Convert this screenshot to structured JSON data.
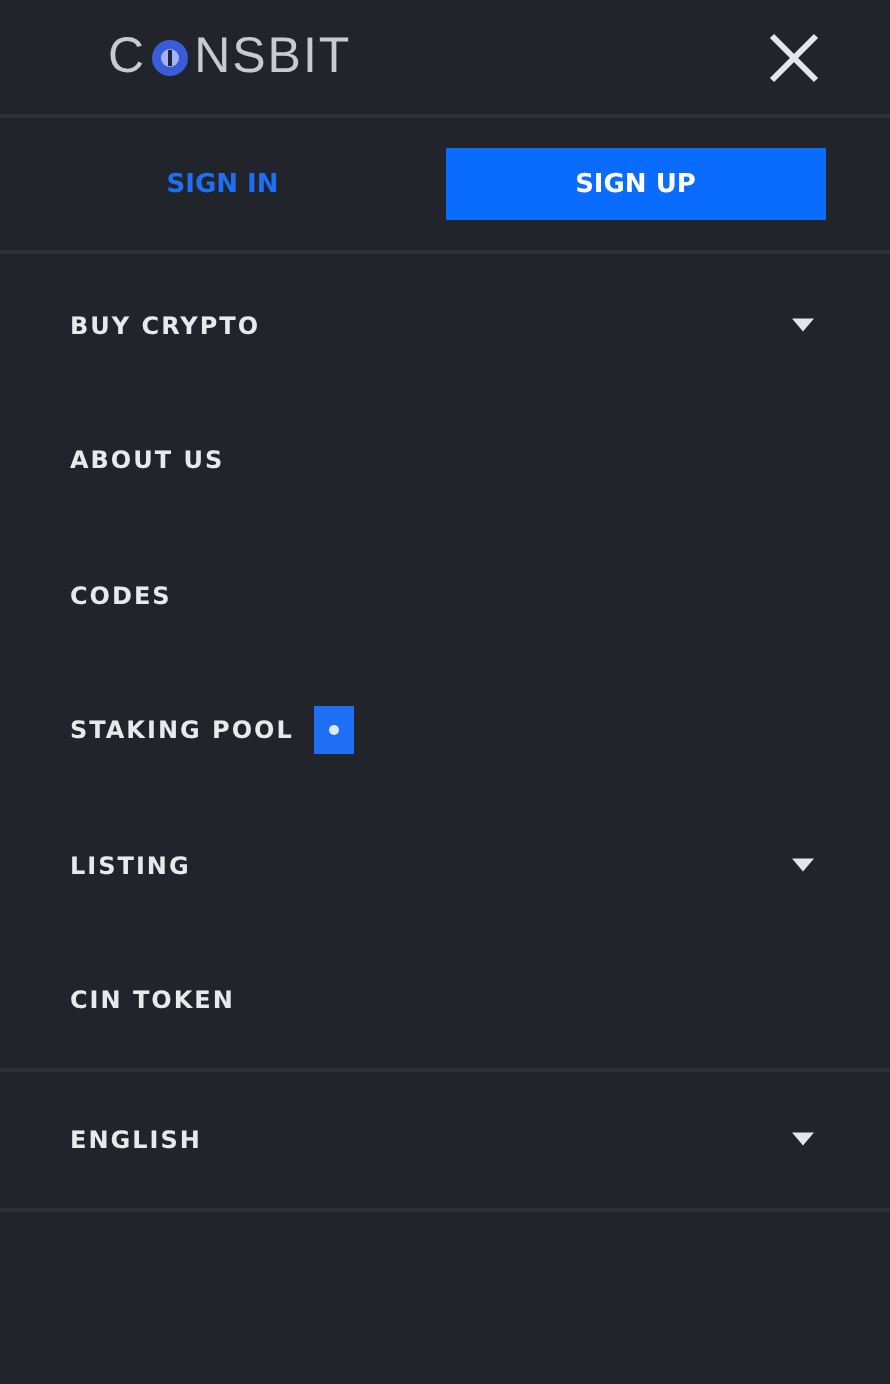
{
  "logo": {
    "before": "C",
    "after": "NSBIT"
  },
  "auth": [
    {
      "label": "SIGN IN",
      "selected": false
    },
    {
      "label": "SIGN UP",
      "selected": true
    }
  ],
  "menu": [
    {
      "label": "BUY CRYPTO",
      "kind": "dropdown"
    },
    {
      "label": "ABOUT US",
      "kind": "link"
    },
    {
      "label": "CODES",
      "kind": "link"
    },
    {
      "label": "STAKING POOL",
      "kind": "badge"
    },
    {
      "label": "LISTING",
      "kind": "dropdown"
    },
    {
      "label": "CIN TOKEN",
      "kind": "link"
    }
  ],
  "language": {
    "label": "ENGLISH",
    "kind": "dropdown"
  }
}
